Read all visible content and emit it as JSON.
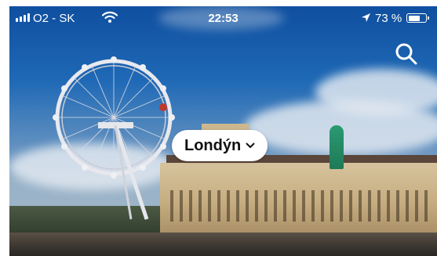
{
  "status_bar": {
    "carrier": "O2 - SK",
    "time": "22:53",
    "battery_percent": "73 %",
    "battery_level": 0.73,
    "icons": [
      "signal-icon",
      "wifi-icon",
      "location-arrow-icon",
      "battery-icon"
    ]
  },
  "header": {
    "city_selector_label": "Londýn",
    "search_icon": "search-icon",
    "chevron_icon": "chevron-down-icon"
  },
  "colors": {
    "pill_background": "#ffffff",
    "text_primary": "#111111",
    "status_text": "#ffffff"
  }
}
